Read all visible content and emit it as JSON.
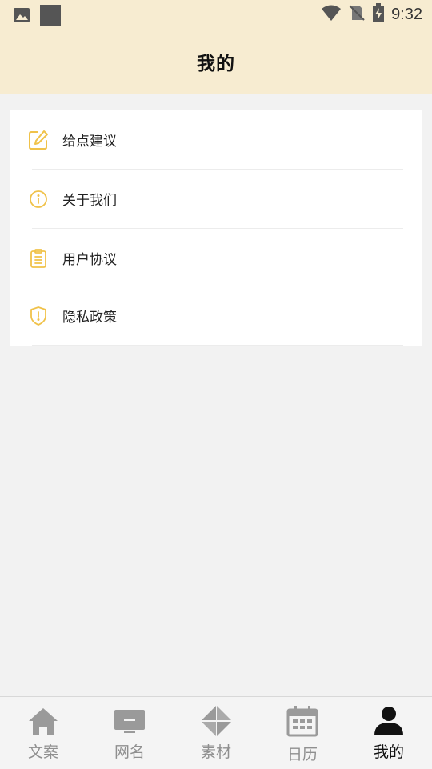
{
  "status_bar": {
    "time": "9:32",
    "icons": [
      "image-icon",
      "app-square-icon",
      "wifi-icon",
      "no-sim-icon",
      "battery-charging-icon"
    ]
  },
  "header": {
    "title": "我的"
  },
  "menu": {
    "items": [
      {
        "label": "给点建议",
        "icon": "edit-icon"
      },
      {
        "label": "关于我们",
        "icon": "info-icon"
      },
      {
        "label": "用户协议",
        "icon": "clipboard-icon"
      },
      {
        "label": "隐私政策",
        "icon": "shield-icon"
      }
    ]
  },
  "bottom_nav": {
    "items": [
      {
        "label": "文案",
        "icon": "home-icon",
        "active": false
      },
      {
        "label": "网名",
        "icon": "monitor-icon",
        "active": false
      },
      {
        "label": "素材",
        "icon": "pinwheel-icon",
        "active": false
      },
      {
        "label": "日历",
        "icon": "calendar-icon",
        "active": false
      },
      {
        "label": "我的",
        "icon": "user-icon",
        "active": true
      }
    ]
  },
  "colors": {
    "header_bg": "#f7ecd1",
    "accent_icon": "#f0c24a",
    "nav_inactive": "#9a9a9a",
    "nav_active": "#111111"
  }
}
